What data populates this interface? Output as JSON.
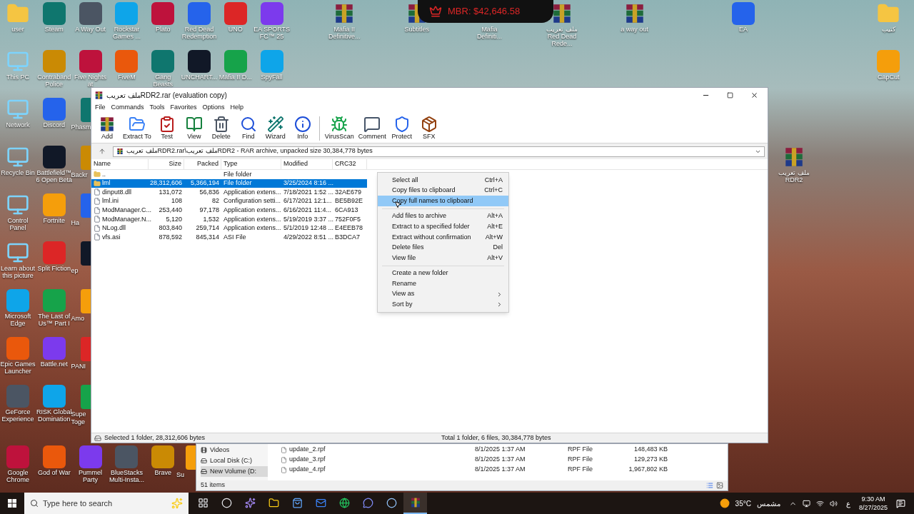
{
  "desktop": {
    "icons": [
      {
        "label": "user",
        "kind": "folder"
      },
      {
        "label": "This PC",
        "kind": "system"
      },
      {
        "label": "Network",
        "kind": "system"
      },
      {
        "label": "Recycle Bin",
        "kind": "system"
      },
      {
        "label": "Control Panel",
        "kind": "system"
      },
      {
        "label": "Learn about this picture",
        "kind": "system"
      },
      {
        "label": "Microsoft Edge",
        "kind": "app"
      },
      {
        "label": "Epic Games Launcher",
        "kind": "app"
      },
      {
        "label": "GeForce Experience",
        "kind": "app"
      },
      {
        "label": "Google Chrome",
        "kind": "app"
      },
      {
        "label": "Steam",
        "kind": "app"
      },
      {
        "label": "Contraband Police",
        "kind": "app"
      },
      {
        "label": "Discord",
        "kind": "app"
      },
      {
        "label": "Battlefield™ 6 Open Beta",
        "kind": "app"
      },
      {
        "label": "Fortnite",
        "kind": "app"
      },
      {
        "label": "Split Fiction",
        "kind": "app"
      },
      {
        "label": "The Last of Us™ Part I",
        "kind": "app"
      },
      {
        "label": "Battle.net",
        "kind": "app"
      },
      {
        "label": "RISK Global Domination",
        "kind": "app"
      },
      {
        "label": "God of War",
        "kind": "app"
      },
      {
        "label": "A Way Out",
        "kind": "app"
      },
      {
        "label": "Five Nights at",
        "kind": "app"
      },
      {
        "label": "Phasm",
        "kind": "cut"
      },
      {
        "label": "Backr",
        "kind": "cut"
      },
      {
        "label": "Ha",
        "kind": "cut"
      },
      {
        "label": "ep",
        "kind": "cut"
      },
      {
        "label": "Amo",
        "kind": "cut"
      },
      {
        "label": "PANI",
        "kind": "cut"
      },
      {
        "label": "Supe Toge",
        "kind": "cut"
      },
      {
        "label": "Pummel Party",
        "kind": "app"
      },
      {
        "label": "Rockstar Games ...",
        "kind": "app"
      },
      {
        "label": "FiveM",
        "kind": "app"
      },
      {
        "label": "BlueStacks Multi-Insta...",
        "kind": "app"
      },
      {
        "label": "Plato",
        "kind": "app"
      },
      {
        "label": "Gang Beasts",
        "kind": "app"
      },
      {
        "label": "Brave",
        "kind": "app"
      },
      {
        "label": "Red Dead Redemption",
        "kind": "app"
      },
      {
        "label": "UNCHART...",
        "kind": "app"
      },
      {
        "label": "Su",
        "kind": "cut"
      },
      {
        "label": "UNO",
        "kind": "app"
      },
      {
        "label": "Mafia II D...",
        "kind": "app"
      },
      {
        "label": "EA SPORTS FC™ 25",
        "kind": "app"
      },
      {
        "label": "SpyFall",
        "kind": "app"
      },
      {
        "label": "Mafia II Definitive...",
        "kind": "archive"
      },
      {
        "label": "Subtitles",
        "kind": "archive"
      },
      {
        "label": "Mafia Definiti...",
        "kind": "archive"
      },
      {
        "label": "ملف تعريب Red Dead Rede...",
        "kind": "archive"
      },
      {
        "label": "a way out",
        "kind": "archive"
      },
      {
        "label": "EA",
        "kind": "app"
      },
      {
        "label": "كتيب",
        "kind": "folder"
      },
      {
        "label": "CapCut",
        "kind": "app"
      },
      {
        "label": "ملف تعريب RDR2",
        "kind": "archive"
      }
    ]
  },
  "overlay_badge": {
    "text": "MBR: $42,646.58"
  },
  "winrar": {
    "title": "ملف تعريبRDR2.rar (evaluation copy)",
    "menu": [
      "File",
      "Commands",
      "Tools",
      "Favorites",
      "Options",
      "Help"
    ],
    "toolbar": [
      "Add",
      "Extract To",
      "Test",
      "View",
      "Delete",
      "Find",
      "Wizard",
      "Info",
      "VirusScan",
      "Comment",
      "Protect",
      "SFX"
    ],
    "path": "ملف تعريبRDR2.rar\\ملف تعريبRDR2 - RAR archive, unpacked size 30,384,778 bytes",
    "columns": [
      "Name",
      "Size",
      "Packed",
      "Type",
      "Modified",
      "CRC32"
    ],
    "rows": [
      {
        "kind": "folder",
        "selected": false,
        "cells": [
          "..",
          "",
          "",
          "File folder",
          "",
          ""
        ]
      },
      {
        "kind": "folder",
        "selected": true,
        "cells": [
          "lml",
          "28,312,606",
          "5,366,194",
          "File folder",
          "3/25/2024 8:16 ...",
          ""
        ]
      },
      {
        "kind": "file",
        "selected": false,
        "cells": [
          "dinput8.dll",
          "131,072",
          "56,836",
          "Application extens...",
          "7/18/2021 1:52 ...",
          "32AE679"
        ]
      },
      {
        "kind": "file",
        "selected": false,
        "cells": [
          "lml.ini",
          "108",
          "82",
          "Configuration setti...",
          "6/17/2021 12:1...",
          "BE5B92E"
        ]
      },
      {
        "kind": "file",
        "selected": false,
        "cells": [
          "ModManager.C...",
          "253,440",
          "97,178",
          "Application extens...",
          "6/16/2021 11:4...",
          "6CA913"
        ]
      },
      {
        "kind": "file",
        "selected": false,
        "cells": [
          "ModManager.N...",
          "5,120",
          "1,532",
          "Application extens...",
          "5/19/2019 3:37 ...",
          "752F0F5"
        ]
      },
      {
        "kind": "file",
        "selected": false,
        "cells": [
          "NLog.dll",
          "803,840",
          "259,714",
          "Application extens...",
          "5/1/2019 12:48 ...",
          "E4EEB78"
        ]
      },
      {
        "kind": "file",
        "selected": false,
        "cells": [
          "vfs.asi",
          "878,592",
          "845,314",
          "ASI File",
          "4/29/2022 8:51 ...",
          "B3DCA7"
        ]
      }
    ],
    "context_menu": [
      [
        {
          "label": "Select all",
          "shortcut": "Ctrl+A",
          "selected": false,
          "submenu": false
        },
        {
          "label": "Copy files to clipboard",
          "shortcut": "Ctrl+C",
          "selected": false,
          "submenu": false
        },
        {
          "label": "Copy full names to clipboard",
          "selected": true,
          "submenu": false
        }
      ],
      [
        {
          "label": "Add files to archive",
          "shortcut": "Alt+A",
          "selected": false,
          "submenu": false
        },
        {
          "label": "Extract to a specified folder",
          "shortcut": "Alt+E",
          "selected": false,
          "submenu": false
        },
        {
          "label": "Extract without confirmation",
          "shortcut": "Alt+W",
          "selected": false,
          "submenu": false
        },
        {
          "label": "Delete files",
          "shortcut": "Del",
          "selected": false,
          "submenu": false
        },
        {
          "label": "View file",
          "shortcut": "Alt+V",
          "selected": false,
          "submenu": false
        }
      ],
      [
        {
          "label": "Create a new folder",
          "selected": false,
          "submenu": false
        },
        {
          "label": "Rename",
          "selected": false,
          "submenu": false
        },
        {
          "label": "View as",
          "selected": false,
          "submenu": true
        },
        {
          "label": "Sort by",
          "selected": false,
          "submenu": true
        }
      ]
    ],
    "status_left": "Selected 1 folder, 28,312,606 bytes",
    "status_right": "Total 1 folder, 6 files, 30,384,778 bytes"
  },
  "explorer": {
    "nav_items": [
      {
        "label": "Videos",
        "kind": "videos",
        "selected": false
      },
      {
        "label": "Local Disk (C:)",
        "kind": "disk",
        "selected": false
      },
      {
        "label": "New Volume (D:",
        "kind": "disk",
        "selected": true
      }
    ],
    "files": [
      {
        "name": "update_2.rpf",
        "date": "8/1/2025 1:37 AM",
        "type": "RPF File",
        "size": "148,483 KB"
      },
      {
        "name": "update_3.rpf",
        "date": "8/1/2025 1:37 AM",
        "type": "RPF File",
        "size": "129,273 KB"
      },
      {
        "name": "update_4.rpf",
        "date": "8/1/2025 1:37 AM",
        "type": "RPF File",
        "size": "1,967,802 KB"
      }
    ],
    "status": "51 items"
  },
  "taskbar": {
    "search_placeholder": "Type here to search",
    "apps": [
      {
        "kind": "taskview",
        "selected": false
      },
      {
        "kind": "recorder",
        "selected": false
      },
      {
        "kind": "copilot",
        "selected": false
      },
      {
        "kind": "explorer",
        "selected": false
      },
      {
        "kind": "store",
        "selected": false
      },
      {
        "kind": "mail",
        "selected": false
      },
      {
        "kind": "browser",
        "selected": false
      },
      {
        "kind": "chat",
        "selected": false
      },
      {
        "kind": "steam",
        "selected": false
      },
      {
        "kind": "winrar",
        "selected": true
      }
    ],
    "weather_temp": "35°C",
    "weather_text": "مشمس",
    "language": "ع",
    "time": "9:30 AM",
    "date": "8/27/2025"
  }
}
